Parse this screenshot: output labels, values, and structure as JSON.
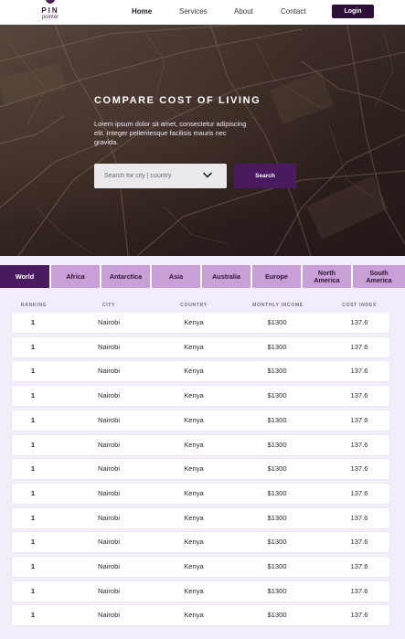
{
  "brand": {
    "name": "PIN",
    "sub": "pointer"
  },
  "nav": {
    "items": [
      "Home",
      "Services",
      "About",
      "Contact"
    ],
    "login": "Login"
  },
  "hero": {
    "title": "COMPARE COST OF LIVING",
    "body": "Lorem ipsum dolor sit amet, consectetur adipiscing elit. Integer pellentesque facilisis mauris nec gravida.",
    "search_placeholder": "Search for city | country",
    "search_button": "Search"
  },
  "tabs": {
    "items": [
      "World",
      "Africa",
      "Antarctica",
      "Asia",
      "Australia",
      "Europe",
      "North America",
      "South America"
    ],
    "active": "World"
  },
  "table": {
    "headers": [
      "RANKING",
      "CITY",
      "COUNTRY",
      "MONTHLY INCOME",
      "COST INDEX"
    ],
    "rows": [
      [
        "1",
        "Nairobi",
        "Kenya",
        "$1300",
        "137.6"
      ],
      [
        "1",
        "Nairobi",
        "Kenya",
        "$1300",
        "137.6"
      ],
      [
        "1",
        "Nairobi",
        "Kenya",
        "$1300",
        "137.6"
      ],
      [
        "1",
        "Nairobi",
        "Kenya",
        "$1300",
        "137.6"
      ],
      [
        "1",
        "Nairobi",
        "Kenya",
        "$1300",
        "137.6"
      ],
      [
        "1",
        "Nairobi",
        "Kenya",
        "$1300",
        "137.6"
      ],
      [
        "1",
        "Nairobi",
        "Kenya",
        "$1300",
        "137.6"
      ],
      [
        "1",
        "Nairobi",
        "Kenya",
        "$1300",
        "137.6"
      ],
      [
        "1",
        "Nairobi",
        "Kenya",
        "$1300",
        "137.6"
      ],
      [
        "1",
        "Nairobi",
        "Kenya",
        "$1300",
        "137.6"
      ],
      [
        "1",
        "Nairobi",
        "Kenya",
        "$1300",
        "137.6"
      ],
      [
        "1",
        "Nairobi",
        "Kenya",
        "$1300",
        "137.6"
      ],
      [
        "1",
        "Nairobi",
        "Kenya",
        "$1300",
        "137.6"
      ]
    ]
  },
  "colors": {
    "primary": "#4a1a5e",
    "tab_inactive": "#c8a0d7",
    "page_bg": "#f3ecfa",
    "login_bg": "#2d0e3b"
  }
}
